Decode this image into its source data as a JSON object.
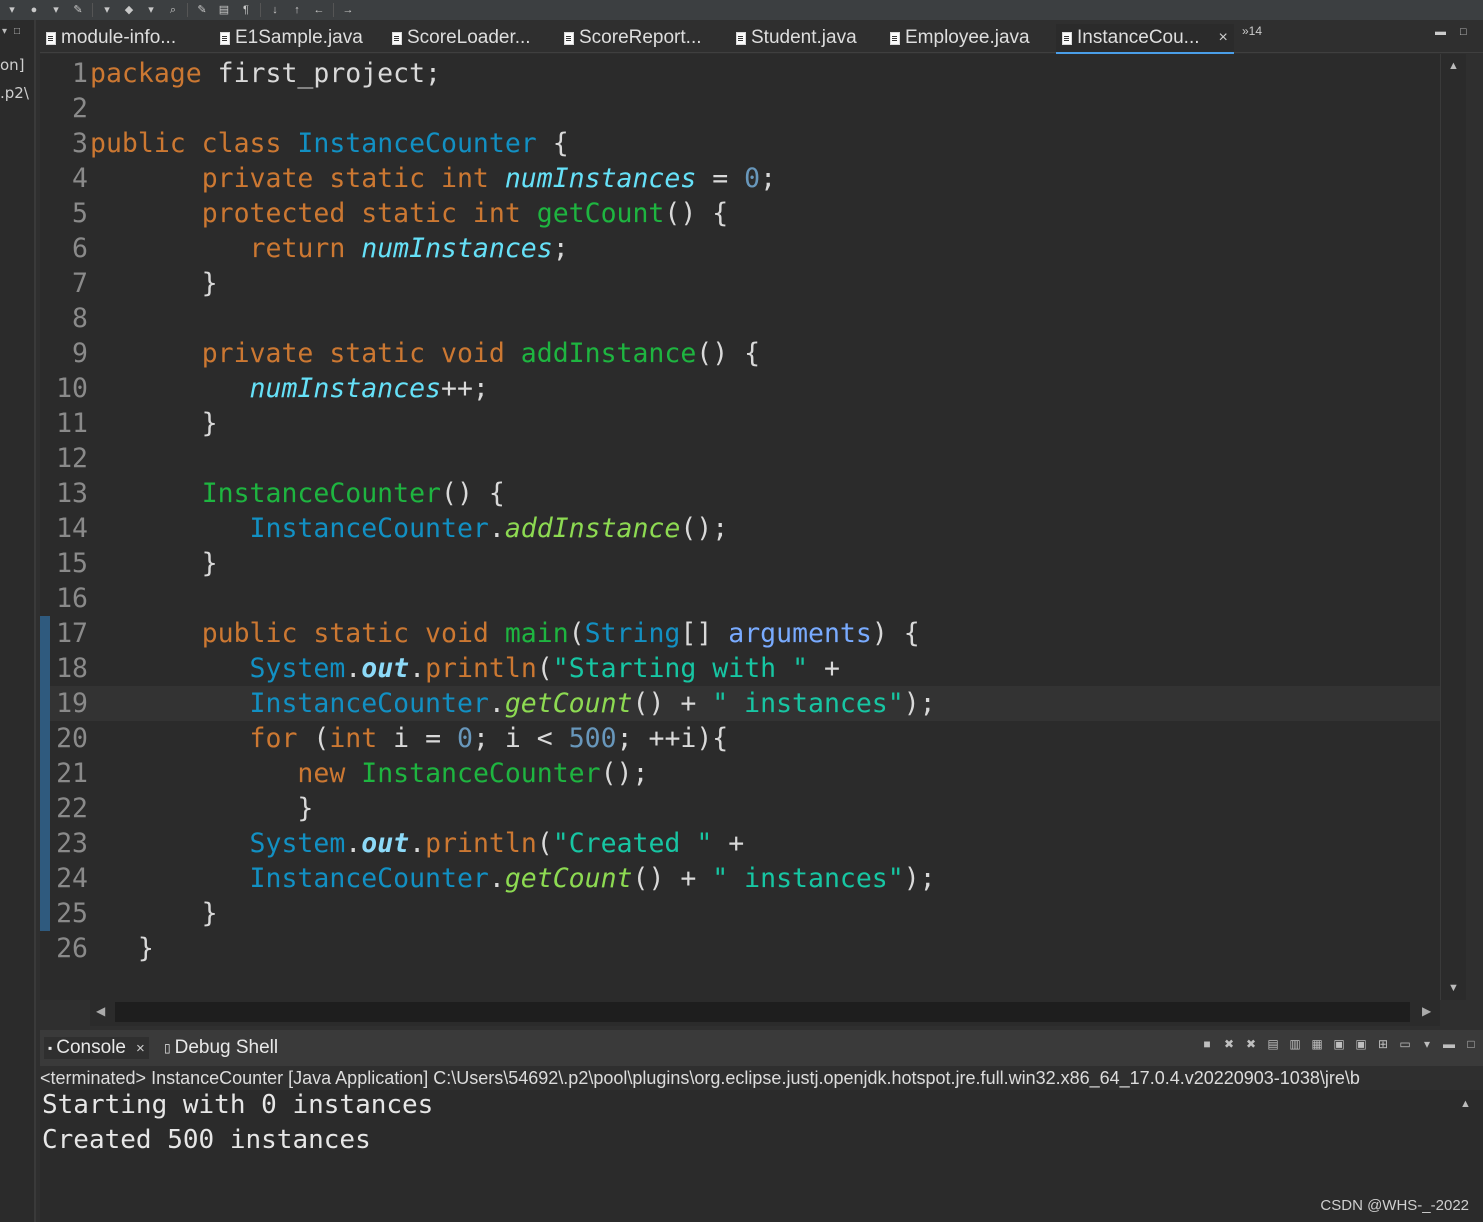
{
  "toolbar": {
    "icons": [
      "new-icon",
      "debug-icon",
      "run-icon",
      "external-tools-icon",
      "new-class-icon",
      "search-icon",
      "pin-icon",
      "toggle-mark-icon",
      "word-wrap-icon",
      "show-whitespace-icon",
      "next-annotation-icon",
      "prev-annotation-icon",
      "back-icon",
      "forward-icon",
      "open-perspective-icon"
    ]
  },
  "left_panel": {
    "line1": "on]",
    "line2": ".p2\\"
  },
  "tabs": [
    {
      "label": "module-info..."
    },
    {
      "label": "E1Sample.java"
    },
    {
      "label": "ScoreLoader..."
    },
    {
      "label": "ScoreReport..."
    },
    {
      "label": "Student.java"
    },
    {
      "label": "Employee.java"
    },
    {
      "label": "InstanceCou...",
      "active": true,
      "close": "×"
    }
  ],
  "more_tabs": "»14",
  "editor": {
    "line_numbers": [
      "1",
      "2",
      "3",
      "4",
      "5",
      "6",
      "7",
      "8",
      "9",
      "10",
      "11",
      "12",
      "13",
      "14",
      "15",
      "16",
      "17",
      "18",
      "19",
      "20",
      "21",
      "22",
      "23",
      "24",
      "25",
      "26"
    ],
    "current_line": 19,
    "lines": [
      [
        {
          "k": "kw",
          "t": "package"
        },
        {
          "k": "",
          "t": " first_project;"
        }
      ],
      [],
      [
        {
          "k": "kw",
          "t": "public class"
        },
        {
          "k": "",
          "t": " "
        },
        {
          "k": "ty",
          "t": "InstanceCounter"
        },
        {
          "k": "",
          "t": " {"
        }
      ],
      [
        {
          "k": "",
          "t": "       "
        },
        {
          "k": "kw",
          "t": "private static int"
        },
        {
          "k": "",
          "t": " "
        },
        {
          "k": "fi",
          "t": "numInstances"
        },
        {
          "k": "",
          "t": " = "
        },
        {
          "k": "nu",
          "t": "0"
        },
        {
          "k": "",
          "t": ";"
        }
      ],
      [
        {
          "k": "",
          "t": "       "
        },
        {
          "k": "kw",
          "t": "protected static int"
        },
        {
          "k": "",
          "t": " "
        },
        {
          "k": "fn",
          "t": "getCount"
        },
        {
          "k": "",
          "t": "() {"
        }
      ],
      [
        {
          "k": "",
          "t": "          "
        },
        {
          "k": "kw",
          "t": "return"
        },
        {
          "k": "",
          "t": " "
        },
        {
          "k": "fi",
          "t": "numInstances"
        },
        {
          "k": "",
          "t": ";"
        }
      ],
      [
        {
          "k": "",
          "t": "       }"
        }
      ],
      [],
      [
        {
          "k": "",
          "t": "       "
        },
        {
          "k": "kw",
          "t": "private static void"
        },
        {
          "k": "",
          "t": " "
        },
        {
          "k": "fn",
          "t": "addInstance"
        },
        {
          "k": "",
          "t": "() {"
        }
      ],
      [
        {
          "k": "",
          "t": "          "
        },
        {
          "k": "fi",
          "t": "numInstances"
        },
        {
          "k": "",
          "t": "++;"
        }
      ],
      [
        {
          "k": "",
          "t": "       }"
        }
      ],
      [],
      [
        {
          "k": "",
          "t": "       "
        },
        {
          "k": "fn",
          "t": "InstanceCounter"
        },
        {
          "k": "",
          "t": "() {"
        }
      ],
      [
        {
          "k": "",
          "t": "          "
        },
        {
          "k": "ty",
          "t": "InstanceCounter"
        },
        {
          "k": "",
          "t": "."
        },
        {
          "k": "sf",
          "t": "addInstance"
        },
        {
          "k": "",
          "t": "();"
        }
      ],
      [
        {
          "k": "",
          "t": "       }"
        }
      ],
      [],
      [
        {
          "k": "",
          "t": "       "
        },
        {
          "k": "kw",
          "t": "public static void"
        },
        {
          "k": "",
          "t": " "
        },
        {
          "k": "fn",
          "t": "main"
        },
        {
          "k": "",
          "t": "("
        },
        {
          "k": "ty",
          "t": "String"
        },
        {
          "k": "",
          "t": "[] "
        },
        {
          "k": "pa",
          "t": "arguments"
        },
        {
          "k": "",
          "t": ") {"
        }
      ],
      [
        {
          "k": "",
          "t": "          "
        },
        {
          "k": "ty",
          "t": "System"
        },
        {
          "k": "",
          "t": "."
        },
        {
          "k": "ou",
          "t": "out"
        },
        {
          "k": "",
          "t": "."
        },
        {
          "k": "kw",
          "t": "println"
        },
        {
          "k": "",
          "t": "("
        },
        {
          "k": "st",
          "t": "\"Starting with \""
        },
        {
          "k": "",
          "t": " +"
        }
      ],
      [
        {
          "k": "",
          "t": "          "
        },
        {
          "k": "ty",
          "t": "InstanceCounter"
        },
        {
          "k": "",
          "t": "."
        },
        {
          "k": "sf",
          "t": "getCount"
        },
        {
          "k": "",
          "t": "() + "
        },
        {
          "k": "st",
          "t": "\" instances\""
        },
        {
          "k": "",
          "t": ");"
        }
      ],
      [
        {
          "k": "",
          "t": "          "
        },
        {
          "k": "kw",
          "t": "for"
        },
        {
          "k": "",
          "t": " ("
        },
        {
          "k": "kw",
          "t": "int"
        },
        {
          "k": "",
          "t": " i = "
        },
        {
          "k": "nu",
          "t": "0"
        },
        {
          "k": "",
          "t": "; i < "
        },
        {
          "k": "nu",
          "t": "500"
        },
        {
          "k": "",
          "t": "; ++i){"
        }
      ],
      [
        {
          "k": "",
          "t": "             "
        },
        {
          "k": "kw",
          "t": "new"
        },
        {
          "k": "",
          "t": " "
        },
        {
          "k": "fn",
          "t": "InstanceCounter"
        },
        {
          "k": "",
          "t": "();"
        }
      ],
      [
        {
          "k": "",
          "t": "             }"
        }
      ],
      [
        {
          "k": "",
          "t": "          "
        },
        {
          "k": "ty",
          "t": "System"
        },
        {
          "k": "",
          "t": "."
        },
        {
          "k": "ou",
          "t": "out"
        },
        {
          "k": "",
          "t": "."
        },
        {
          "k": "kw",
          "t": "println"
        },
        {
          "k": "",
          "t": "("
        },
        {
          "k": "st",
          "t": "\"Created \""
        },
        {
          "k": "",
          "t": " +"
        }
      ],
      [
        {
          "k": "",
          "t": "          "
        },
        {
          "k": "ty",
          "t": "InstanceCounter"
        },
        {
          "k": "",
          "t": "."
        },
        {
          "k": "sf",
          "t": "getCount"
        },
        {
          "k": "",
          "t": "() + "
        },
        {
          "k": "st",
          "t": "\" instances\""
        },
        {
          "k": "",
          "t": ");"
        }
      ],
      [
        {
          "k": "",
          "t": "       }"
        }
      ],
      [
        {
          "k": "",
          "t": "   }"
        }
      ]
    ]
  },
  "console": {
    "tabs": [
      {
        "label": "Console",
        "close": "×",
        "active": true
      },
      {
        "label": "Debug Shell"
      }
    ],
    "status": "<terminated> InstanceCounter [Java Application] C:\\Users\\54692\\.p2\\pool\\plugins\\org.eclipse.justj.openjdk.hotspot.jre.full.win32.x86_64_17.0.4.v20220903-1038\\jre\\b",
    "output": [
      "Starting with 0 instances",
      "Created 500 instances"
    ]
  },
  "watermark": "CSDN @WHS-_-2022"
}
